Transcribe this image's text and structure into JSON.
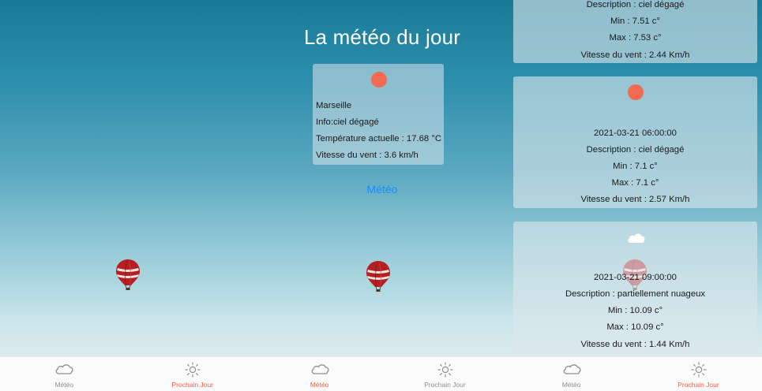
{
  "tabs": {
    "meteo_label": "Météo",
    "prochain_label": "Prochain Jour"
  },
  "screen2": {
    "title": "La météo du jour",
    "city": "Marseille",
    "info": "Info:ciel dégagé",
    "temperature": "Température actuelle : 17.68 °C",
    "wind": "Vitesse du vent : 3.6 km/h",
    "link": "Météo"
  },
  "screen3": {
    "cards": [
      {
        "description": "Description : ciel dégagé",
        "min": "Min : 7.51 c°",
        "max": "Max : 7.53 c°",
        "wind": "Vitesse du vent : 2.44 Km/h"
      },
      {
        "time": "2021-03-21 06:00:00",
        "description": "Description : ciel dégagé",
        "min": "Min : 7.1 c°",
        "max": "Max : 7.1 c°",
        "wind": "Vitesse du vent : 2.57 Km/h"
      },
      {
        "time": "2021-03-21 09:00:00",
        "description": "Description : partiellement nuageux",
        "min": "Min : 10.09 c°",
        "max": "Max : 10.09 c°",
        "wind": "Vitesse du vent : 1.44 Km/h"
      }
    ]
  },
  "colors": {
    "accent": "#ff5a3c",
    "link": "#1a8cff",
    "sun": "#f26a4f",
    "tab_inactive": "#8e8e93"
  },
  "icons": [
    "cloud-icon",
    "sun-icon",
    "hot-air-balloon"
  ]
}
